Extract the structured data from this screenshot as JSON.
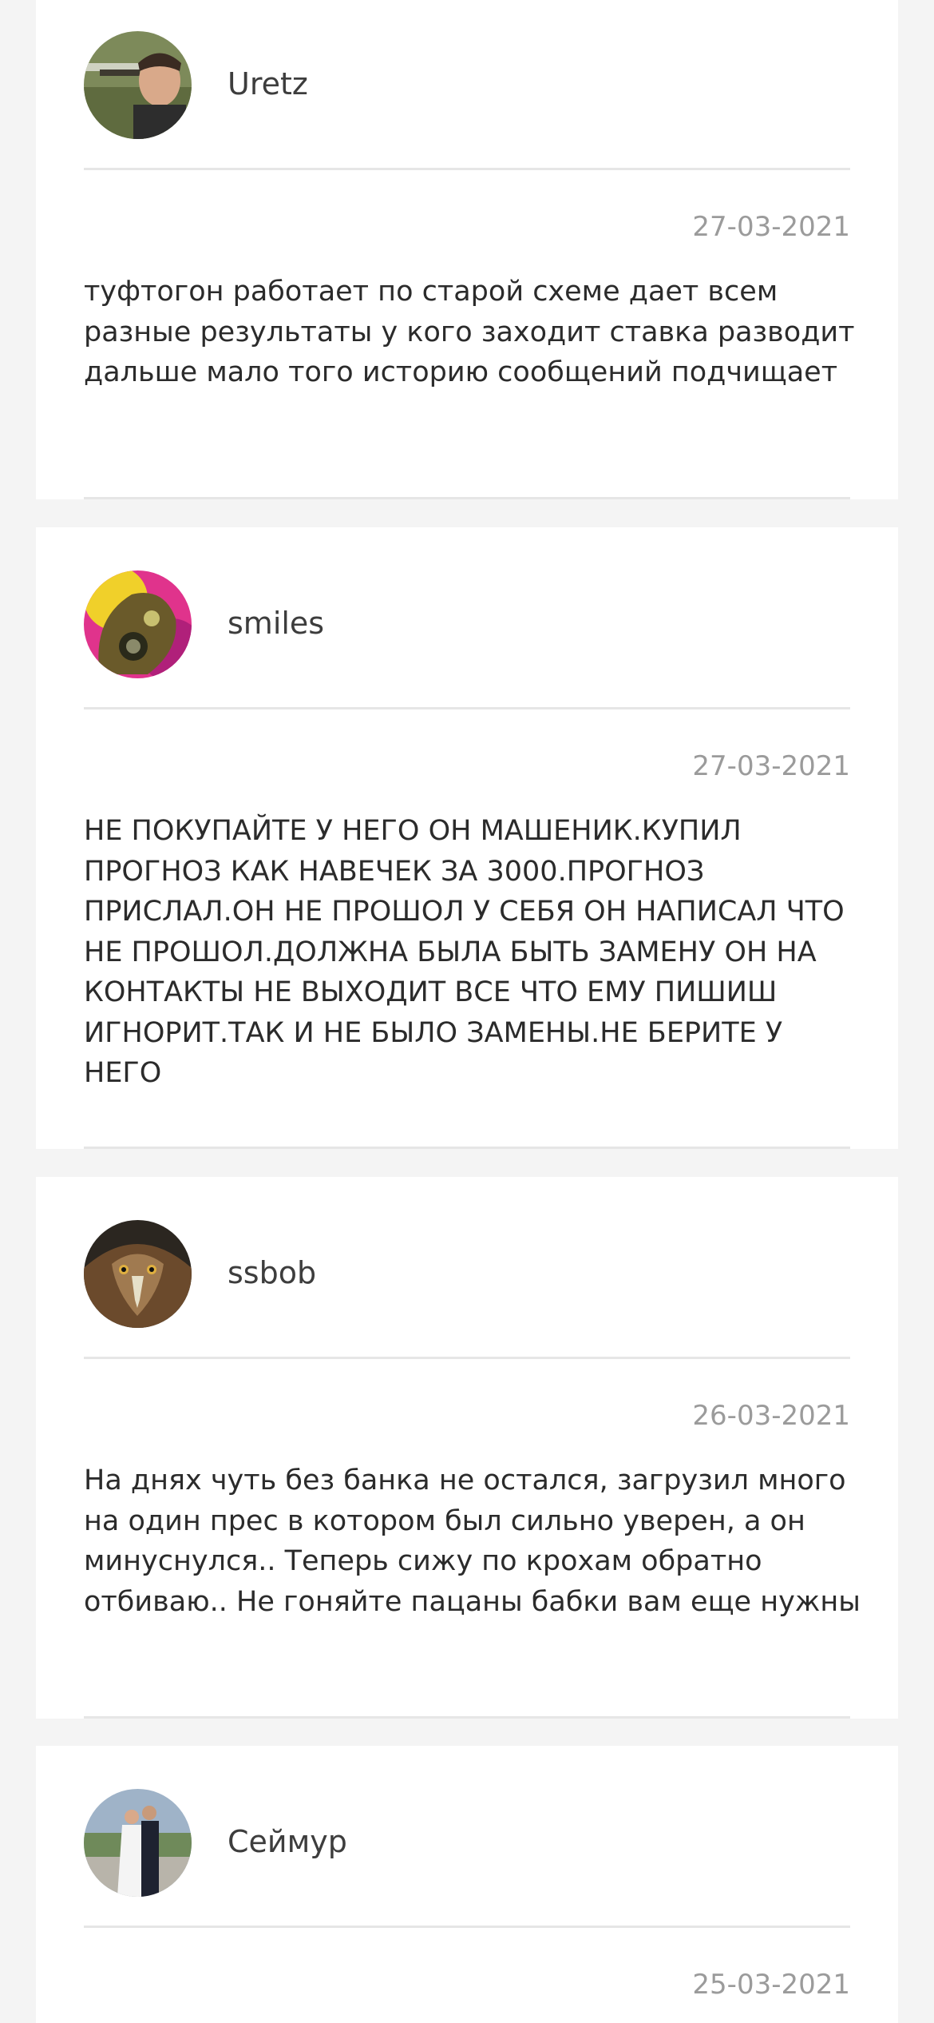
{
  "comments": [
    {
      "author": "Uretz",
      "avatar_icon": "user-photo-man-rifle-icon",
      "date": "27-03-2021",
      "text": "туфтогон работает по старой схеме дает всем разные результаты у кого заходит ставка разводит дальше мало того историю сообщений подчищает"
    },
    {
      "author": "smiles",
      "avatar_icon": "gas-mask-art-icon",
      "date": "27-03-2021",
      "text": "НЕ ПОКУПАЙТЕ У НЕГО ОН МАШЕНИК.КУПИЛ ПРОГНОЗ КАК НАВЕЧЕК ЗА 3000.ПРОГНОЗ ПРИСЛАЛ.ОН НЕ ПРОШОЛ У СЕБЯ ОН НАПИСАЛ ЧТО НЕ ПРОШОЛ.ДОЛЖНА БЫЛА БЫТЬ ЗАМЕНУ ОН НА КОНТАКТЫ НЕ ВЫХОДИТ ВСЕ ЧТО ЕМУ ПИШИШ ИГНОРИТ.ТАК И НЕ БЫЛО ЗАМЕНЫ.НЕ БЕРИТЕ У НЕГО"
    },
    {
      "author": "ssbob",
      "avatar_icon": "eagle-icon",
      "date": "26-03-2021",
      "text": "На днях чуть без банка не остался, загрузил много на один прес в котором был сильно уверен, а он минуснулся.. Теперь сижу по крохам обратно отбиваю.. Не гоняйте пацаны бабки вам еще нужны"
    },
    {
      "author": "Сеймур",
      "avatar_icon": "couple-photo-icon",
      "date": "25-03-2021",
      "text": ""
    }
  ]
}
